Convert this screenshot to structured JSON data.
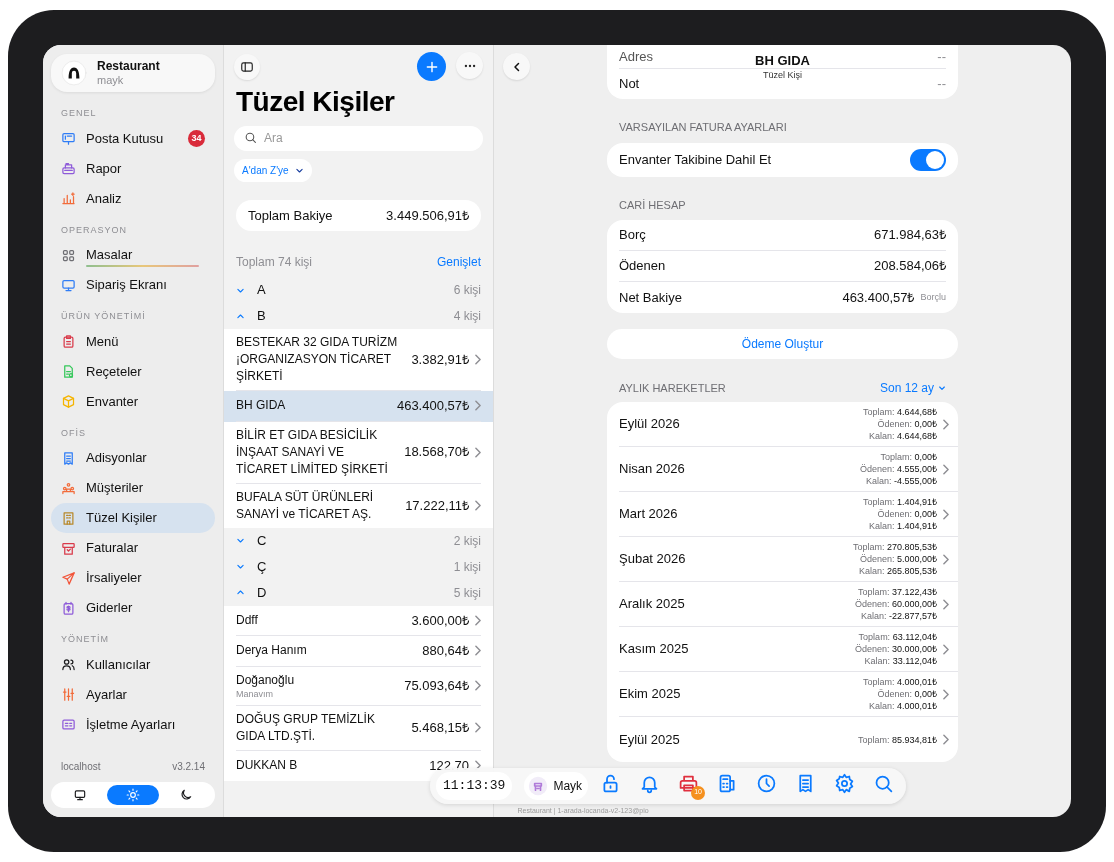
{
  "sidebar": {
    "profile": {
      "name": "Restaurant",
      "user": "mayk"
    },
    "sections": [
      {
        "title": "GENEL",
        "items": [
          {
            "label": "Posta Kutusu",
            "selected": false,
            "badge": "34"
          },
          {
            "label": "Rapor",
            "selected": false
          },
          {
            "label": "Analiz",
            "selected": false
          }
        ]
      },
      {
        "title": "OPERASYON",
        "items": [
          {
            "label": "Masalar",
            "selected": false,
            "underline": true
          },
          {
            "label": "Sipariş Ekranı",
            "selected": false
          }
        ]
      },
      {
        "title": "ÜRÜN YÖNETİMİ",
        "items": [
          {
            "label": "Menü",
            "selected": false
          },
          {
            "label": "Reçeteler",
            "selected": false
          },
          {
            "label": "Envanter",
            "selected": false
          }
        ]
      },
      {
        "title": "OFİS",
        "items": [
          {
            "label": "Adisyonlar",
            "selected": false
          },
          {
            "label": "Müşteriler",
            "selected": false
          },
          {
            "label": "Tüzel Kişiler",
            "selected": true
          },
          {
            "label": "Faturalar",
            "selected": false
          },
          {
            "label": "İrsaliyeler",
            "selected": false
          },
          {
            "label": "Giderler",
            "selected": false
          }
        ]
      },
      {
        "title": "YÖNETİM",
        "items": [
          {
            "label": "Kullanıcılar",
            "selected": false
          },
          {
            "label": "Ayarlar",
            "selected": false
          },
          {
            "label": "İşletme Ayarları",
            "selected": false
          }
        ]
      }
    ],
    "footer": {
      "host": "localhost",
      "version": "v3.2.14"
    },
    "theme_options": [
      {
        "selected": false
      },
      {
        "selected": true
      },
      {
        "selected": false
      }
    ]
  },
  "list": {
    "title": "Tüzel Kişiler",
    "search": {
      "placeholder": "Ara"
    },
    "sort": "A'dan Z'ye",
    "total": {
      "label": "Toplam Bakiye",
      "value": "3.449.506,91₺"
    },
    "count": "Toplam 74 kişi",
    "expand": "Genişlet",
    "groups": [
      {
        "letter": "A",
        "count": "6 kişi",
        "expanded": false
      },
      {
        "letter": "B",
        "count": "4 kişi",
        "expanded": true,
        "entries": [
          {
            "name": "BESTEKAR 32 GIDA TURİZM ¡ORGANIZASYON TİCARET ŞİRKETİ",
            "amount": "3.382,91₺",
            "selected": false
          },
          {
            "name": "BH GIDA",
            "amount": "463.400,57₺",
            "selected": true
          },
          {
            "name": "BİLİR ET GIDA BESİCİLİK İNŞAAT SANAYİ VE TİCARET LİMİTED ŞİRKETİ",
            "amount": "18.568,70₺",
            "selected": false
          },
          {
            "name": "BUFALA SÜT ÜRÜNLERİ SANAYİ ve TİCARET AŞ.",
            "amount": "17.222,11₺",
            "selected": false
          }
        ]
      },
      {
        "letter": "C",
        "count": "2 kişi",
        "expanded": false
      },
      {
        "letter": "Ç",
        "count": "1 kişi",
        "expanded": false
      },
      {
        "letter": "D",
        "count": "5 kişi",
        "expanded": true,
        "entries": [
          {
            "name": "Ddff",
            "amount": "3.600,00₺",
            "selected": false
          },
          {
            "name": "Derya Hanım",
            "amount": "880,64₺",
            "selected": false
          },
          {
            "name": "Doğanoğlu",
            "subtitle": "Manavım",
            "amount": "75.093,64₺",
            "selected": false
          },
          {
            "name": "DOĞUŞ GRUP TEMİZLİK GIDA LTD.ŞTİ.",
            "amount": "5.468,15₺",
            "selected": false
          },
          {
            "name": "DUKKAN B",
            "amount": "122.70",
            "selected": false
          }
        ]
      }
    ]
  },
  "detail": {
    "title": "BH GIDA",
    "subtitle": "Tüzel Kişi",
    "info_rows": [
      {
        "label": "Adres",
        "value": "--"
      },
      {
        "label": "Not",
        "value": "--"
      }
    ],
    "invoice_settings": {
      "title": "VARSAYILAN FATURA AYARLARI",
      "label": "Envanter Takibine Dahil Et",
      "on": true
    },
    "account": {
      "title": "CARİ HESAP",
      "rows": [
        {
          "label": "Borç",
          "value": "671.984,63₺"
        },
        {
          "label": "Ödenen",
          "value": "208.584,06₺"
        },
        {
          "label": "Net Bakiye",
          "value": "463.400,57₺",
          "note": "Borçlu"
        }
      ]
    },
    "payment_button": "Ödeme Oluştur",
    "monthly": {
      "title": "AYLIK HAREKETLER",
      "range": "Son 12 ay",
      "rows": [
        {
          "month": "Eylül 2026",
          "lines": [
            {
              "label": "Toplam:",
              "value": "4.644,68₺"
            },
            {
              "label": "Ödenen:",
              "value": "0,00₺"
            },
            {
              "label": "Kalan:",
              "value": "4.644,68₺"
            }
          ]
        },
        {
          "month": "Nisan 2026",
          "lines": [
            {
              "label": "Toplam:",
              "value": "0,00₺"
            },
            {
              "label": "Ödenen:",
              "value": "4.555,00₺"
            },
            {
              "label": "Kalan:",
              "value": "-4.555,00₺"
            }
          ]
        },
        {
          "month": "Mart 2026",
          "lines": [
            {
              "label": "Toplam:",
              "value": "1.404,91₺"
            },
            {
              "label": "Ödenen:",
              "value": "0,00₺"
            },
            {
              "label": "Kalan:",
              "value": "1.404,91₺"
            }
          ]
        },
        {
          "month": "Şubat 2026",
          "lines": [
            {
              "label": "Toplam:",
              "value": "270.805,53₺"
            },
            {
              "label": "Ödenen:",
              "value": "5.000,00₺"
            },
            {
              "label": "Kalan:",
              "value": "265.805,53₺"
            }
          ]
        },
        {
          "month": "Aralık 2025",
          "lines": [
            {
              "label": "Toplam:",
              "value": "37.122,43₺"
            },
            {
              "label": "Ödenen:",
              "value": "60.000,00₺"
            },
            {
              "label": "Kalan:",
              "value": "-22.877,57₺"
            }
          ]
        },
        {
          "month": "Kasım 2025",
          "lines": [
            {
              "label": "Toplam:",
              "value": "63.112,04₺"
            },
            {
              "label": "Ödenen:",
              "value": "30.000,00₺"
            },
            {
              "label": "Kalan:",
              "value": "33.112,04₺"
            }
          ]
        },
        {
          "month": "Ekim 2025",
          "lines": [
            {
              "label": "Toplam:",
              "value": "4.000,01₺"
            },
            {
              "label": "Ödenen:",
              "value": "0,00₺"
            },
            {
              "label": "Kalan:",
              "value": "4.000,01₺"
            }
          ]
        },
        {
          "month": "Eylül 2025",
          "lines": [
            {
              "label": "Toplam:",
              "value": "85.934,81₺"
            }
          ]
        }
      ]
    }
  },
  "toolbar": {
    "time": "11:13:39",
    "user": "Mayk",
    "printer_badge": "10",
    "footer": "Restaurant | 1-arada-locanda-v2-123@pio"
  }
}
